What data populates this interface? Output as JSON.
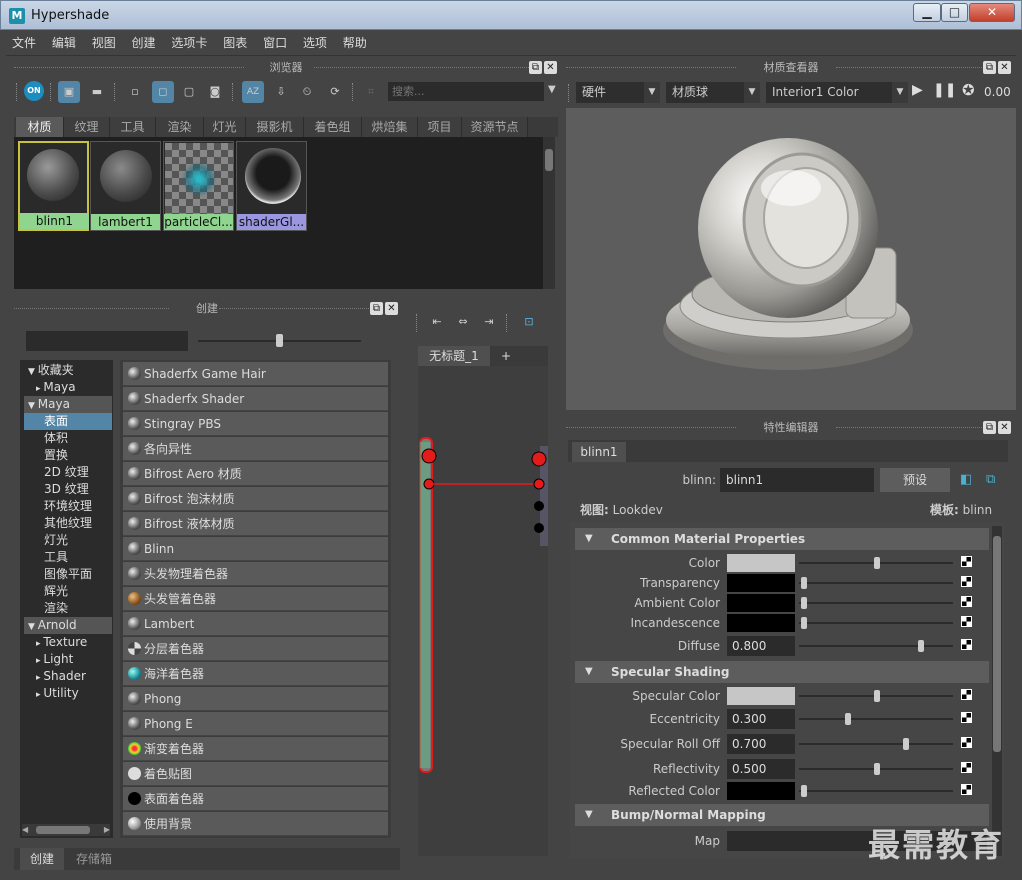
{
  "window": {
    "title": "Hypershade",
    "app_icon": "M"
  },
  "menu": [
    "文件",
    "编辑",
    "视图",
    "创建",
    "选项卡",
    "图表",
    "窗口",
    "选项",
    "帮助"
  ],
  "browser": {
    "title": "浏览器",
    "search_placeholder": "搜索...",
    "toggle_label": "ON",
    "tabs": [
      "材质",
      "纹理",
      "工具",
      "渲染",
      "灯光",
      "摄影机",
      "着色组",
      "烘焙集",
      "项目",
      "资源节点"
    ],
    "swatches": [
      {
        "label": "blinn1",
        "label_color": "#8fd48f"
      },
      {
        "label": "lambert1",
        "label_color": "#8fd48f"
      },
      {
        "label": "particleCl...",
        "label_color": "#8fd48f"
      },
      {
        "label": "shaderGl...",
        "label_color": "#9b96e0"
      }
    ]
  },
  "viewer": {
    "title": "材质查看器",
    "renderer": "硬件",
    "geometry": "材质球",
    "environment": "Interior1 Color",
    "exposure": "0.00"
  },
  "create": {
    "title": "创建",
    "categories": [
      {
        "label": "收藏夹",
        "type": "group"
      },
      {
        "label": "Maya",
        "type": "sub"
      },
      {
        "label": "Maya",
        "type": "group-selected"
      },
      {
        "label": "表面",
        "type": "selected"
      },
      {
        "label": "体积",
        "type": "item"
      },
      {
        "label": "置换",
        "type": "item"
      },
      {
        "label": "2D 纹理",
        "type": "item"
      },
      {
        "label": "3D 纹理",
        "type": "item"
      },
      {
        "label": "环境纹理",
        "type": "item"
      },
      {
        "label": "其他纹理",
        "type": "item"
      },
      {
        "label": "灯光",
        "type": "item"
      },
      {
        "label": "工具",
        "type": "item"
      },
      {
        "label": "图像平面",
        "type": "item"
      },
      {
        "label": "辉光",
        "type": "item"
      },
      {
        "label": "渲染",
        "type": "item"
      },
      {
        "label": "Arnold",
        "type": "group-selected"
      },
      {
        "label": "Texture",
        "type": "sub"
      },
      {
        "label": "Light",
        "type": "sub"
      },
      {
        "label": "Shader",
        "type": "sub"
      },
      {
        "label": "Utility",
        "type": "sub"
      }
    ],
    "nodes": [
      "Shaderfx Game Hair",
      "Shaderfx Shader",
      "Stingray PBS",
      "各向异性",
      "Bifrost Aero 材质",
      "Bifrost 泡沫材质",
      "Bifrost 液体材质",
      "Blinn",
      "头发物理着色器",
      "头发管着色器",
      "Lambert",
      "分层着色器",
      "海洋着色器",
      "Phong",
      "Phong E",
      "渐变着色器",
      "着色贴图",
      "表面着色器",
      "使用背景"
    ],
    "bottom_tabs": [
      "创建",
      "存储箱"
    ]
  },
  "graph": {
    "tab": "无标题_1",
    "add_tab": "+"
  },
  "attr_editor": {
    "title": "特性编辑器",
    "node_tab": "blinn1",
    "type_label": "blinn:",
    "node_name": "blinn1",
    "preset_button": "预设",
    "view_label": "视图:",
    "view_value": "Lookdev",
    "template_label": "模板:",
    "template_value": "blinn",
    "sections": {
      "common": "Common Material Properties",
      "specular": "Specular Shading",
      "bump": "Bump/Normal Mapping"
    },
    "common_attrs": [
      {
        "label": "Color",
        "kind": "color",
        "color": "#c6c6c6",
        "slider": 0.5
      },
      {
        "label": "Transparency",
        "kind": "color",
        "color": "#000000",
        "slider": 0.0
      },
      {
        "label": "Ambient Color",
        "kind": "color",
        "color": "#000000",
        "slider": 0.0
      },
      {
        "label": "Incandescence",
        "kind": "color",
        "color": "#000000",
        "slider": 0.0
      },
      {
        "label": "Diffuse",
        "kind": "num",
        "value": "0.800",
        "slider": 0.8
      }
    ],
    "specular_attrs": [
      {
        "label": "Specular Color",
        "kind": "color",
        "color": "#c6c6c6",
        "slider": 0.5
      },
      {
        "label": "Eccentricity",
        "kind": "num",
        "value": "0.300",
        "slider": 0.3
      },
      {
        "label": "Specular Roll Off",
        "kind": "num",
        "value": "0.700",
        "slider": 0.7
      },
      {
        "label": "Reflectivity",
        "kind": "num",
        "value": "0.500",
        "slider": 0.5
      },
      {
        "label": "Reflected Color",
        "kind": "color",
        "color": "#000000",
        "slider": 0.0
      }
    ],
    "bump_map_label": "Map"
  },
  "watermark": "最需教育"
}
